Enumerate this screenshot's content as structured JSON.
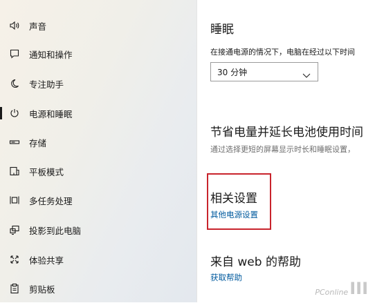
{
  "sidebar": {
    "items": [
      {
        "label": "声音",
        "icon": "speaker-icon"
      },
      {
        "label": "通知和操作",
        "icon": "notification-icon"
      },
      {
        "label": "专注助手",
        "icon": "moon-icon"
      },
      {
        "label": "电源和睡眠",
        "icon": "power-icon",
        "active": true
      },
      {
        "label": "存储",
        "icon": "storage-icon"
      },
      {
        "label": "平板模式",
        "icon": "tablet-icon"
      },
      {
        "label": "多任务处理",
        "icon": "multitask-icon"
      },
      {
        "label": "投影到此电脑",
        "icon": "projection-icon"
      },
      {
        "label": "体验共享",
        "icon": "share-icon"
      },
      {
        "label": "剪贴板",
        "icon": "clipboard-icon"
      }
    ]
  },
  "main": {
    "sleep": {
      "title": "睡眠",
      "description": "在接通电源的情况下，电脑在经过以下时间",
      "selected_value": "30 分钟"
    },
    "battery": {
      "title": "节省电量并延长电池使用时间",
      "description": "通过选择更短的屏幕显示时长和睡眠设置，"
    },
    "related": {
      "title": "相关设置",
      "link": "其他电源设置"
    },
    "help": {
      "title": "来自 web 的帮助",
      "link": "获取帮助"
    }
  },
  "watermark": {
    "text_small": "PConline",
    "text_large": "ⅠⅠⅠ"
  },
  "colors": {
    "link": "#005a9e",
    "highlight": "#c8232c"
  }
}
